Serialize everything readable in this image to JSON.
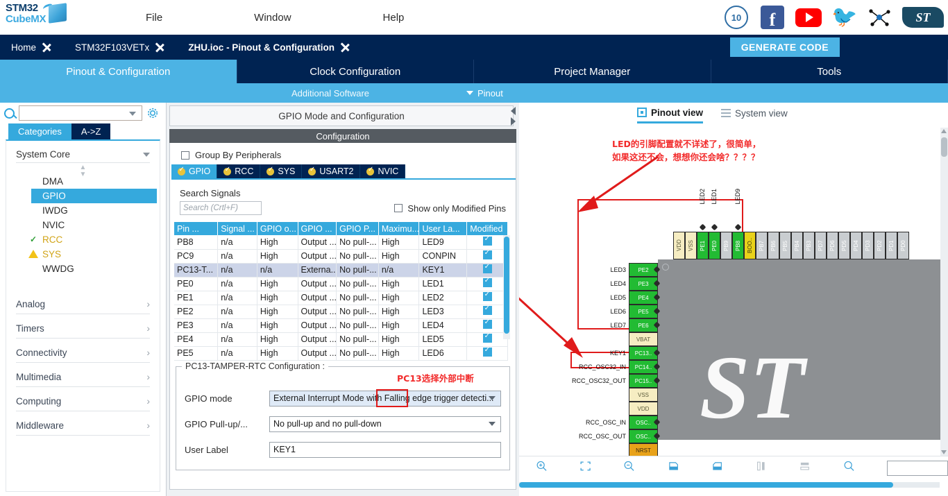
{
  "app": {
    "logo_line1": "STM32",
    "logo_line2": "CubeMX"
  },
  "menu": {
    "items": [
      {
        "label": "File"
      },
      {
        "label": "Window"
      },
      {
        "label": "Help"
      }
    ],
    "social": [
      {
        "name": "anniversary-badge",
        "label": "10"
      },
      {
        "name": "facebook-icon",
        "label": "f"
      },
      {
        "name": "youtube-icon",
        "label": ""
      },
      {
        "name": "twitter-icon",
        "label": ""
      },
      {
        "name": "community-icon",
        "label": ""
      },
      {
        "name": "st-logo",
        "label": "ST"
      }
    ]
  },
  "breadcrumb": {
    "items": [
      "Home",
      "STM32F103VETx",
      "ZHU.ioc - Pinout & Configuration"
    ],
    "generate_code": "GENERATE CODE"
  },
  "main_tabs": [
    {
      "label": "Pinout & Configuration",
      "active": true
    },
    {
      "label": "Clock Configuration",
      "active": false
    },
    {
      "label": "Project Manager",
      "active": false
    },
    {
      "label": "Tools",
      "active": false
    }
  ],
  "subbar": {
    "additional_software": "Additional Software",
    "pinout": "Pinout"
  },
  "sidebar": {
    "search_placeholder": "",
    "tabs": [
      {
        "label": "Categories",
        "active": true
      },
      {
        "label": "A->Z",
        "active": false
      }
    ],
    "group": {
      "title": "System Core",
      "items": [
        {
          "label": "DMA",
          "state": "none"
        },
        {
          "label": "GPIO",
          "state": "selected"
        },
        {
          "label": "IWDG",
          "state": "none"
        },
        {
          "label": "NVIC",
          "state": "none"
        },
        {
          "label": "RCC",
          "state": "check"
        },
        {
          "label": "SYS",
          "state": "warn"
        },
        {
          "label": "WWDG",
          "state": "none"
        }
      ]
    },
    "categories": [
      {
        "label": "Analog"
      },
      {
        "label": "Timers"
      },
      {
        "label": "Connectivity"
      },
      {
        "label": "Multimedia"
      },
      {
        "label": "Computing"
      },
      {
        "label": "Middleware"
      }
    ]
  },
  "middle": {
    "panel_title": "GPIO Mode and Configuration",
    "configuration_strip": "Configuration",
    "group_by_peripherals": "Group By Peripherals",
    "peripheral_tabs": [
      {
        "label": "GPIO",
        "active": true
      },
      {
        "label": "RCC",
        "active": false
      },
      {
        "label": "SYS",
        "active": false
      },
      {
        "label": "USART2",
        "active": false
      },
      {
        "label": "NVIC",
        "active": false
      }
    ],
    "search_signals_label": "Search Signals",
    "search_signals_placeholder": "Search (Crtl+F)",
    "show_only_modified": "Show only Modified Pins",
    "table": {
      "columns": [
        "Pin ...",
        "Signal ...",
        "GPIO o...",
        "GPIO ...",
        "GPIO P...",
        "Maximu...",
        "User La...",
        "Modified"
      ],
      "rows": [
        {
          "pin": "PB8",
          "signal": "n/a",
          "out": "High",
          "mode": "Output ...",
          "pull": "No pull-...",
          "speed": "High",
          "label": "LED9",
          "modified": true,
          "selected": false
        },
        {
          "pin": "PC9",
          "signal": "n/a",
          "out": "High",
          "mode": "Output ...",
          "pull": "No pull-...",
          "speed": "High",
          "label": "CONPIN",
          "modified": true,
          "selected": false
        },
        {
          "pin": "PC13-T...",
          "signal": "n/a",
          "out": "n/a",
          "mode": "Externa...",
          "pull": "No pull-...",
          "speed": "n/a",
          "label": "KEY1",
          "modified": true,
          "selected": true
        },
        {
          "pin": "PE0",
          "signal": "n/a",
          "out": "High",
          "mode": "Output ...",
          "pull": "No pull-...",
          "speed": "High",
          "label": "LED1",
          "modified": true,
          "selected": false
        },
        {
          "pin": "PE1",
          "signal": "n/a",
          "out": "High",
          "mode": "Output ...",
          "pull": "No pull-...",
          "speed": "High",
          "label": "LED2",
          "modified": true,
          "selected": false
        },
        {
          "pin": "PE2",
          "signal": "n/a",
          "out": "High",
          "mode": "Output ...",
          "pull": "No pull-...",
          "speed": "High",
          "label": "LED3",
          "modified": true,
          "selected": false
        },
        {
          "pin": "PE3",
          "signal": "n/a",
          "out": "High",
          "mode": "Output ...",
          "pull": "No pull-...",
          "speed": "High",
          "label": "LED4",
          "modified": true,
          "selected": false
        },
        {
          "pin": "PE4",
          "signal": "n/a",
          "out": "High",
          "mode": "Output ...",
          "pull": "No pull-...",
          "speed": "High",
          "label": "LED5",
          "modified": true,
          "selected": false
        },
        {
          "pin": "PE5",
          "signal": "n/a",
          "out": "High",
          "mode": "Output ...",
          "pull": "No pull-...",
          "speed": "High",
          "label": "LED6",
          "modified": true,
          "selected": false
        }
      ]
    },
    "config_group": {
      "legend": "PC13-TAMPER-RTC Configuration :",
      "annotation": "PC13选择外部中断",
      "fields": [
        {
          "label": "GPIO mode",
          "value": "External Interrupt Mode with Falling edge trigger detecti...",
          "type": "select",
          "highlighted": true
        },
        {
          "label": "GPIO Pull-up/...",
          "value": "No pull-up and no pull-down",
          "type": "select",
          "highlighted": false
        },
        {
          "label": "User Label",
          "value": "KEY1",
          "type": "text",
          "highlighted": false
        }
      ]
    }
  },
  "right": {
    "view_tabs": [
      {
        "label": "Pinout view",
        "active": true
      },
      {
        "label": "System view",
        "active": false
      }
    ],
    "annotation": {
      "line1": "LED的引脚配置就不详述了，很简单，",
      "line2": "如果这还不会，想想你还会啥？？？？"
    },
    "chip": {
      "watermark": "ST",
      "top_pins": [
        {
          "name": "VDD",
          "color": "cream",
          "label": ""
        },
        {
          "name": "VSS",
          "color": "cream",
          "label": ""
        },
        {
          "name": "PE1",
          "color": "green",
          "label": "LED2"
        },
        {
          "name": "PE0",
          "color": "green",
          "label": "LED1"
        },
        {
          "name": "PB9",
          "color": "grey",
          "label": ""
        },
        {
          "name": "PB8",
          "color": "green",
          "label": "LED9"
        },
        {
          "name": "BOO..",
          "color": "yellow",
          "label": ""
        },
        {
          "name": "PB7",
          "color": "grey",
          "label": ""
        },
        {
          "name": "PB6",
          "color": "grey",
          "label": ""
        },
        {
          "name": "PB5",
          "color": "grey",
          "label": ""
        },
        {
          "name": "PB4",
          "color": "grey",
          "label": ""
        },
        {
          "name": "PB3",
          "color": "grey",
          "label": ""
        },
        {
          "name": "PD7",
          "color": "grey",
          "label": ""
        },
        {
          "name": "PD6",
          "color": "grey",
          "label": ""
        },
        {
          "name": "PD5",
          "color": "grey",
          "label": ""
        },
        {
          "name": "PD4",
          "color": "grey",
          "label": ""
        },
        {
          "name": "PD3",
          "color": "grey",
          "label": ""
        },
        {
          "name": "PD2",
          "color": "grey",
          "label": ""
        },
        {
          "name": "PD1",
          "color": "grey",
          "label": ""
        },
        {
          "name": "PD0",
          "color": "grey",
          "label": ""
        }
      ],
      "left_pins": [
        {
          "name": "PE2",
          "color": "green",
          "label": "LED3"
        },
        {
          "name": "PE3",
          "color": "green",
          "label": "LED4"
        },
        {
          "name": "PE4",
          "color": "green",
          "label": "LED5"
        },
        {
          "name": "PE5",
          "color": "green",
          "label": "LED6"
        },
        {
          "name": "PE6",
          "color": "green",
          "label": "LED7"
        },
        {
          "name": "VBAT",
          "color": "cream",
          "label": ""
        },
        {
          "name": "PC13..",
          "color": "green",
          "label": "KEY1"
        },
        {
          "name": "PC14..",
          "color": "green",
          "label": "RCC_OSC32_IN"
        },
        {
          "name": "PC15..",
          "color": "green",
          "label": "RCC_OSC32_OUT"
        },
        {
          "name": "VSS",
          "color": "cream",
          "label": ""
        },
        {
          "name": "VDD",
          "color": "cream",
          "label": ""
        },
        {
          "name": "OSC..",
          "color": "green",
          "label": "RCC_OSC_IN"
        },
        {
          "name": "OSC..",
          "color": "green",
          "label": "RCC_OSC_OUT"
        },
        {
          "name": "NRST",
          "color": "orange",
          "label": ""
        }
      ]
    },
    "toolbar": [
      {
        "name": "zoom-in-icon"
      },
      {
        "name": "fit-to-screen-icon"
      },
      {
        "name": "zoom-out-icon"
      },
      {
        "name": "rotate-right-icon"
      },
      {
        "name": "rotate-left-icon"
      },
      {
        "name": "flip-vertical-icon"
      },
      {
        "name": "flip-horizontal-icon"
      },
      {
        "name": "search-icon"
      }
    ],
    "toolbar_search_value": ""
  }
}
